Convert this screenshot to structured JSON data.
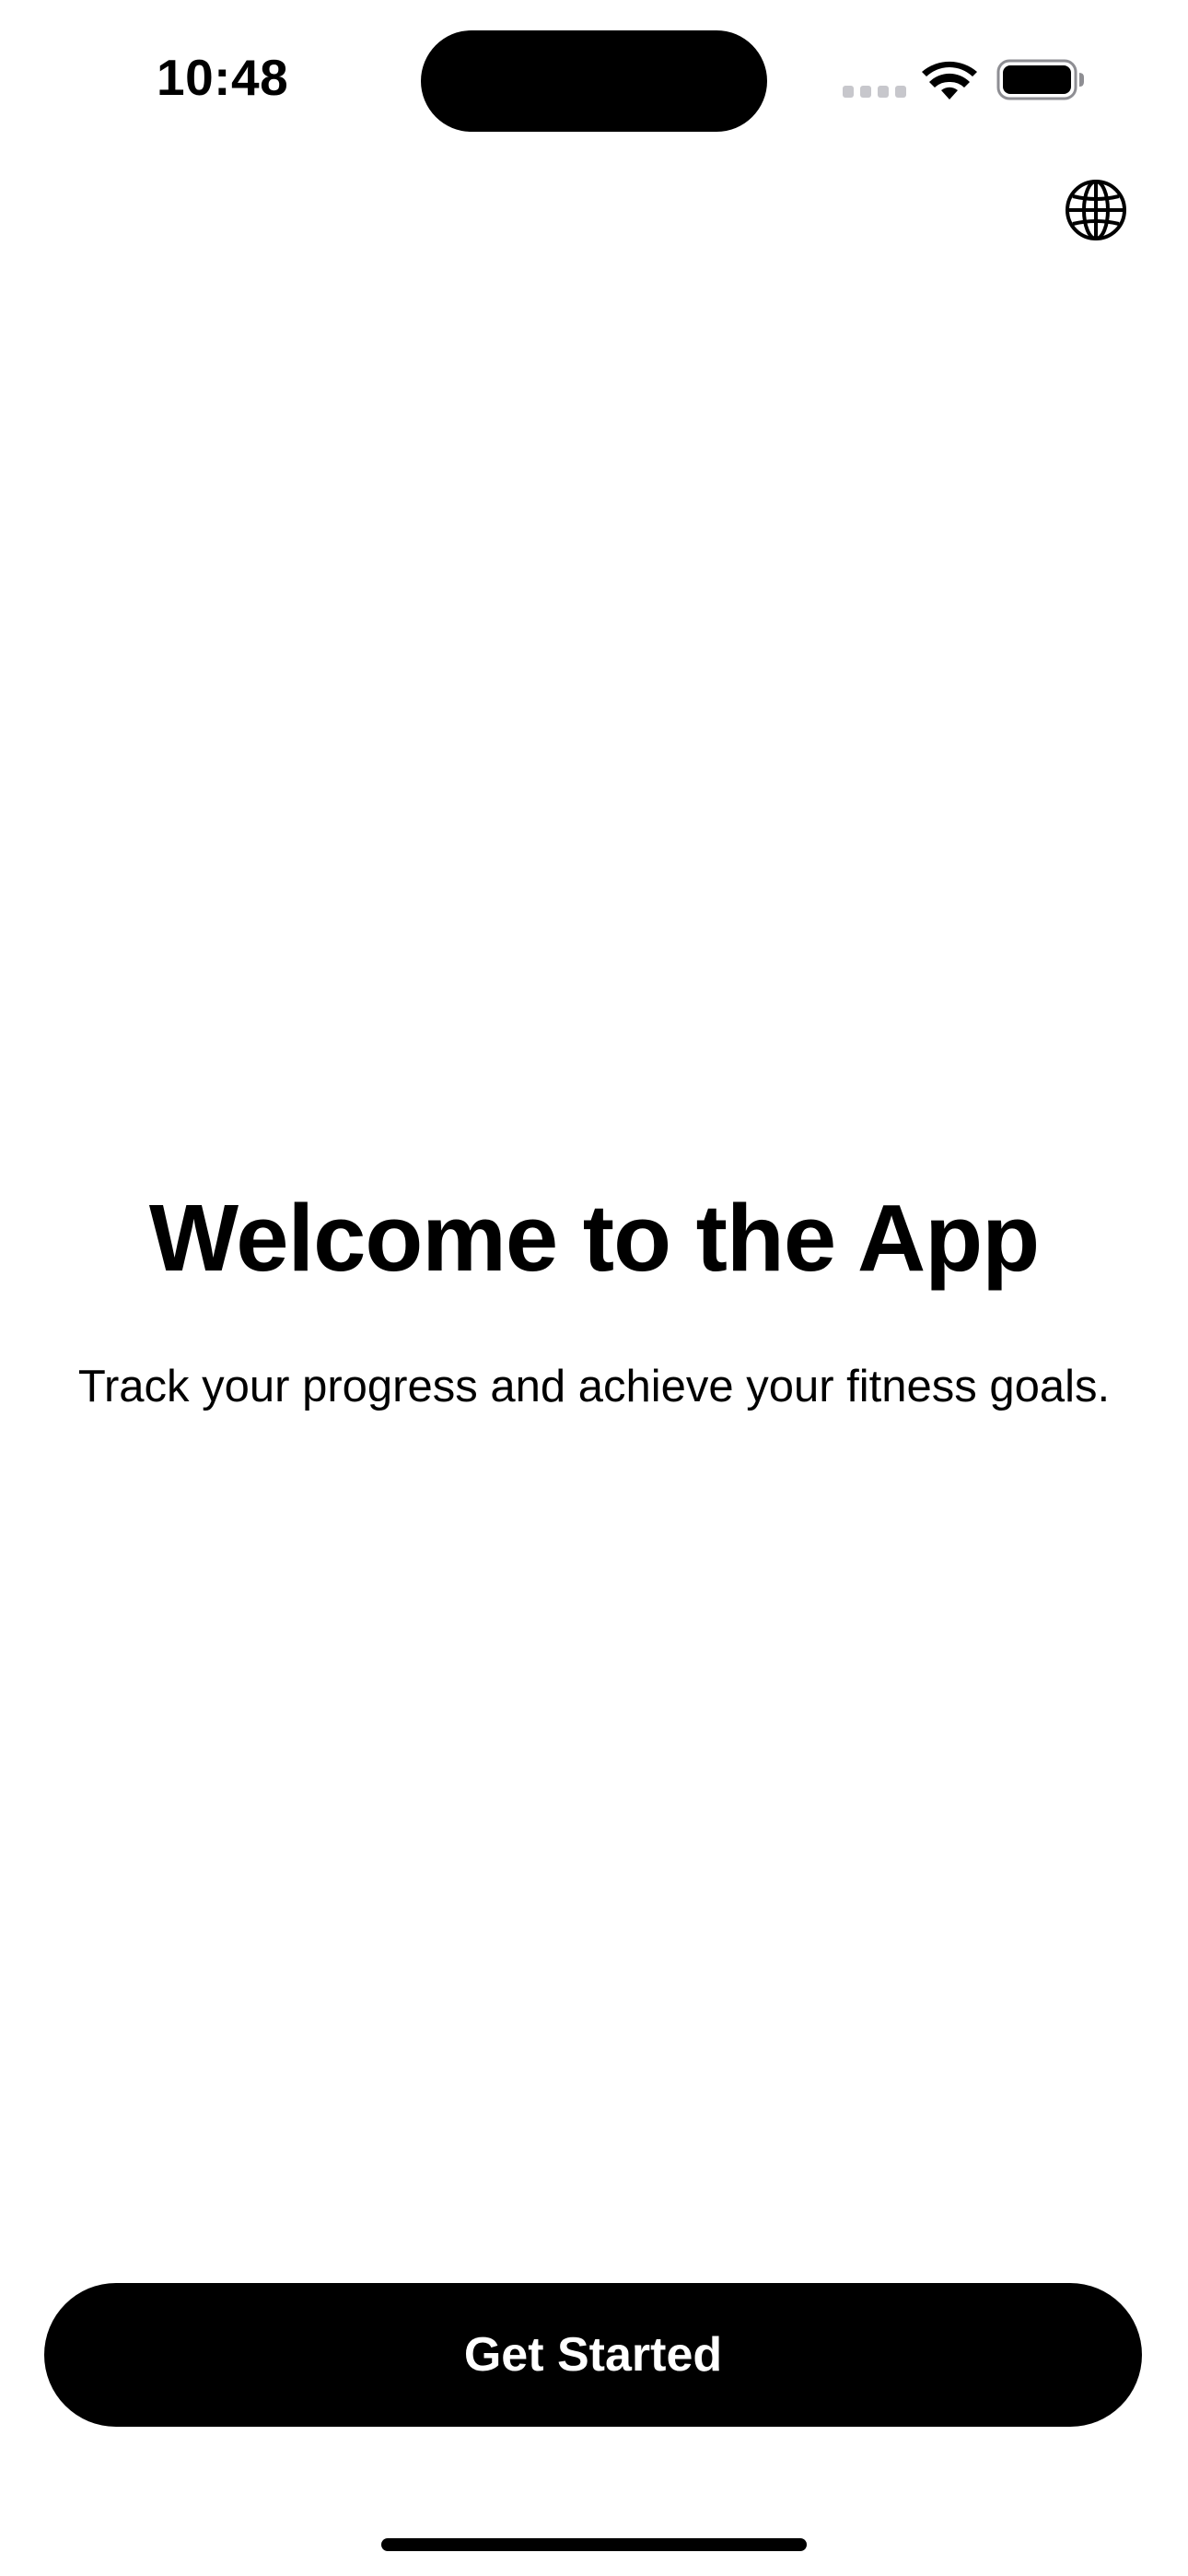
{
  "status_bar": {
    "time": "10:48",
    "icons": [
      "cellular-signal-icon",
      "wifi-icon",
      "battery-icon"
    ]
  },
  "header": {
    "language_icon": "globe-icon"
  },
  "main": {
    "title": "Welcome to the App",
    "subtitle": "Track your progress and achieve your fitness goals."
  },
  "footer": {
    "get_started_label": "Get Started"
  },
  "colors": {
    "background": "#ffffff",
    "primary": "#000000",
    "button_text": "#ffffff"
  }
}
